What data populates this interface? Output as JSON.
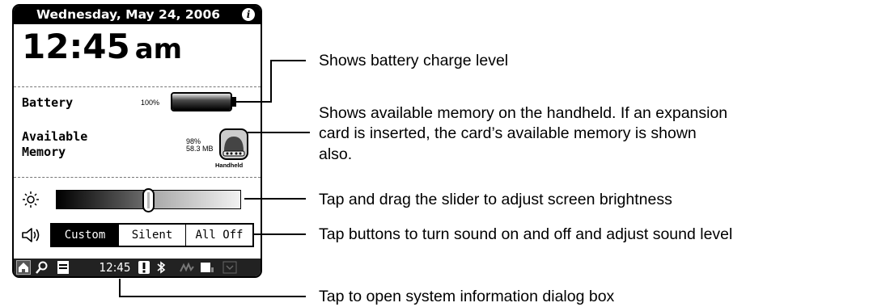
{
  "status_screen": {
    "date": "Wednesday, May 24, 2006",
    "info_icon": "info-icon",
    "time": "12:45",
    "ampm": "am",
    "battery": {
      "label": "Battery",
      "percent_text": "100%",
      "charge_level": 1.0
    },
    "memory": {
      "label_line1": "Available",
      "label_line2": "Memory",
      "percent_text": "98%",
      "size_text": "58.3 MB",
      "device_label": "Handheld"
    },
    "brightness": {
      "icon": "sun-icon",
      "level": 0.5
    },
    "sound": {
      "icon": "speaker-icon",
      "buttons": [
        {
          "label": "Custom",
          "selected": true
        },
        {
          "label": "Silent",
          "selected": false
        },
        {
          "label": "All Off",
          "selected": false
        }
      ]
    },
    "taskbar": {
      "icons": [
        "home-icon",
        "find-icon",
        "menu-icon",
        "alert-icon",
        "bluetooth-icon",
        "graffiti-icon",
        "input-area-icon",
        "hide-input-icon"
      ],
      "clock": "12:45"
    }
  },
  "callouts": {
    "battery": "Shows battery charge level",
    "memory_line1": "Shows available memory on the handheld. If an expansion",
    "memory_line2": "card is inserted, the card’s available memory is shown",
    "memory_line3": "also.",
    "brightness": "Tap and drag the slider to adjust screen brightness",
    "sound": "Tap buttons to turn sound on and off and adjust sound level",
    "system_info": "Tap to open system information dialog box"
  }
}
